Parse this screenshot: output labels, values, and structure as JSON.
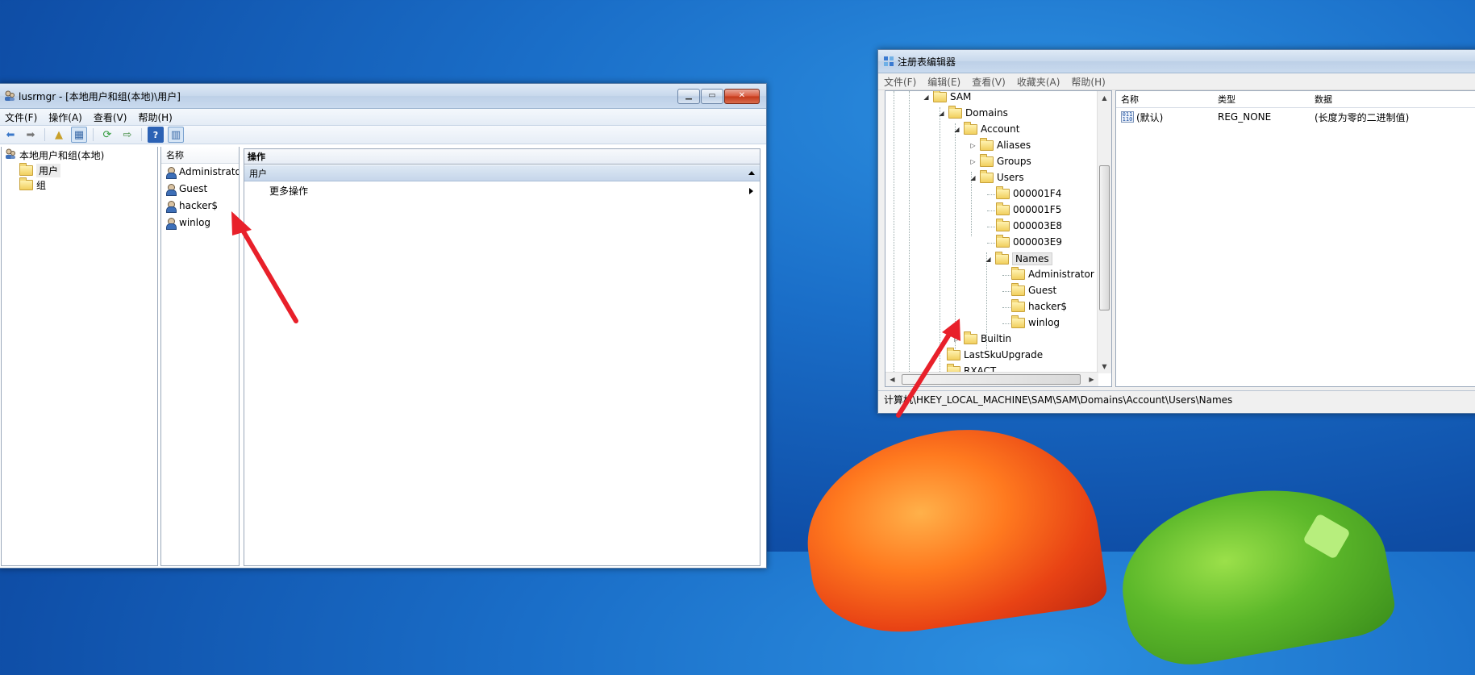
{
  "lusrmgr": {
    "title": "lusrmgr - [本地用户和组(本地)\\用户]",
    "menu": [
      "文件(F)",
      "操作(A)",
      "查看(V)",
      "帮助(H)"
    ],
    "tree_root": "本地用户和组(本地)",
    "tree_items": [
      "用户",
      "组"
    ],
    "list_header": "名称",
    "users": [
      "Administrato",
      "Guest",
      "hacker$",
      "winlog"
    ],
    "actions_header": "操作",
    "actions_section": "用户",
    "more_actions": "更多操作"
  },
  "regedit": {
    "title": "注册表编辑器",
    "menu": [
      "文件(F)",
      "编辑(E)",
      "查看(V)",
      "收藏夹(A)",
      "帮助(H)"
    ],
    "tree": {
      "sam": "SAM",
      "domains": "Domains",
      "account": "Account",
      "aliases": "Aliases",
      "groups": "Groups",
      "users": "Users",
      "rids": [
        "000001F4",
        "000001F5",
        "000003E8",
        "000003E9"
      ],
      "names": "Names",
      "name_children": [
        "Administrator",
        "Guest",
        "hacker$",
        "winlog"
      ],
      "builtin": "Builtin",
      "lastsku": "LastSkuUpgrade",
      "rxact": "RXACT"
    },
    "columns": [
      "名称",
      "类型",
      "数据"
    ],
    "values": [
      {
        "name": "(默认)",
        "type": "REG_NONE",
        "data": "(长度为零的二进制值)",
        "icon": "binary-value-icon",
        "icon_text": "011\n110"
      }
    ],
    "status": "计算机\\HKEY_LOCAL_MACHINE\\SAM\\SAM\\Domains\\Account\\Users\\Names"
  },
  "colors": {
    "arrow": "#e8202a",
    "desktop": "#1a6ec8"
  }
}
